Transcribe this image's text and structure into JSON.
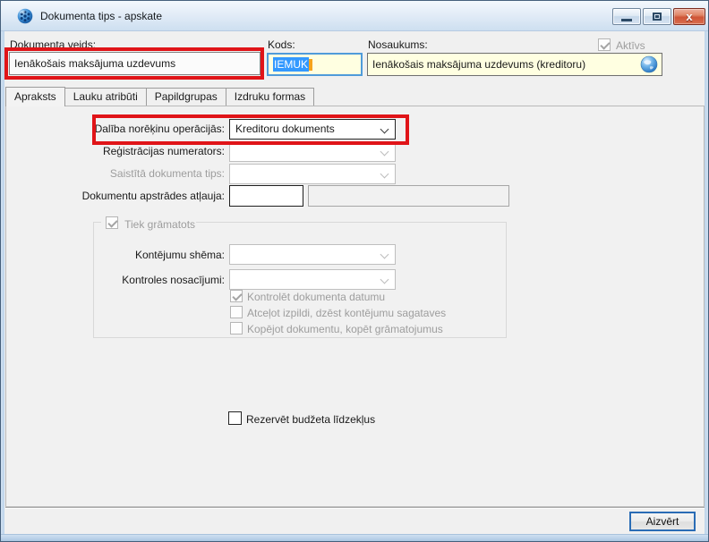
{
  "window": {
    "title": "Dokumenta tips - apskate"
  },
  "header": {
    "document_kind": {
      "label": "Dokumenta veids:",
      "value": "Ienākošais maksājuma uzdevums"
    },
    "code": {
      "label": "Kods:",
      "value": "IEMUK",
      "selected": true
    },
    "name": {
      "label": "Nosaukums:",
      "value": "Ienākošais maksājuma uzdevums (kreditoru)"
    },
    "active": {
      "label": "Aktīvs",
      "checked": true,
      "disabled": true
    }
  },
  "tabs": [
    {
      "label": "Apraksts",
      "active": true
    },
    {
      "label": "Lauku atribūti",
      "active": false
    },
    {
      "label": "Papildgrupas",
      "active": false
    },
    {
      "label": "Izdruku formas",
      "active": false
    }
  ],
  "form": {
    "participation": {
      "label": "Dalība norēķinu operācijās:",
      "value": "Kreditoru dokuments",
      "enabled": true
    },
    "numerator": {
      "label": "Reģistrācijas numerators:",
      "value": "",
      "enabled": false
    },
    "related_type": {
      "label": "Saistītā dokumenta tips:",
      "value": "",
      "enabled": false
    },
    "processing_permission": {
      "label": "Dokumentu apstrādes atļauja:",
      "value1": "",
      "value2": ""
    },
    "posting_group": {
      "label": "Tiek grāmatots",
      "checked": true,
      "scheme": {
        "label": "Kontējumu shēma:",
        "value": ""
      },
      "control_conditions": {
        "label": "Kontroles nosacījumi:",
        "value": ""
      },
      "checkboxes": [
        {
          "label": "Kontrolēt dokumenta datumu",
          "checked": true
        },
        {
          "label": "Atceļot izpildi, dzēst kontējumu sagataves",
          "checked": false
        },
        {
          "label": "Kopējot dokumentu, kopēt grāmatojumus",
          "checked": false
        }
      ]
    },
    "reserve_budget": {
      "label": "Rezervēt budžeta līdzekļus",
      "checked": false
    }
  },
  "footer": {
    "close_label": "Aizvērt"
  },
  "colors": {
    "annotation_red": "#e01418",
    "field_yellow": "#ffffe1",
    "selection_blue": "#3399ff",
    "titlebar_blue": "#dfeaf6",
    "default_button_border": "#2a6cb5"
  }
}
